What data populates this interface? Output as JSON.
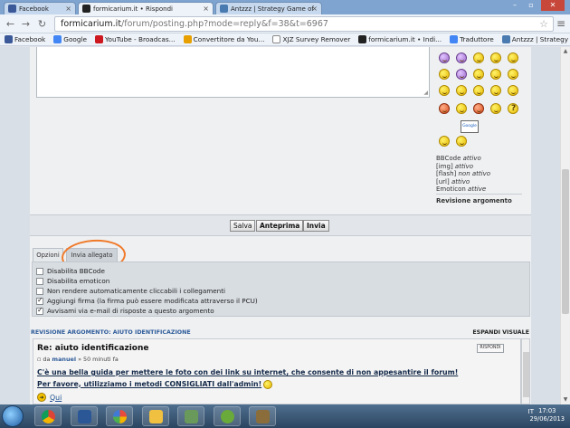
{
  "browser": {
    "tabs": [
      {
        "title": "Facebook",
        "favicon": "facebook-icon",
        "color": "#3b5998"
      },
      {
        "title": "formicarium.it • Rispondi",
        "favicon": "ant-icon",
        "color": "#222222"
      },
      {
        "title": "Antzzz | Strategy Game of",
        "favicon": "antzzz-icon",
        "color": "#4a7bb0"
      }
    ],
    "url_host": "formicarium.it",
    "url_path": "/forum/posting.php?mode=reply&f=38&t=6967",
    "bookmarks": [
      {
        "label": "Facebook",
        "icon": "facebook-icon",
        "color": "#3b5998"
      },
      {
        "label": "Google",
        "icon": "google-icon",
        "color": "#4285f4"
      },
      {
        "label": "YouTube - Broadcas...",
        "icon": "youtube-icon",
        "color": "#cc181e"
      },
      {
        "label": "Convertitore da You...",
        "icon": "converter-icon",
        "color": "#e8a000"
      },
      {
        "label": "XJZ Survey Remover",
        "icon": "page-icon",
        "color": "#ffffff"
      },
      {
        "label": "formicarium.it • Indi...",
        "icon": "ant-icon",
        "color": "#222222"
      },
      {
        "label": "Traduttore",
        "icon": "translate-icon",
        "color": "#4285f4"
      },
      {
        "label": "Antzzz | Strategy Ga...",
        "icon": "antzzz-icon",
        "color": "#4a7bb0"
      }
    ]
  },
  "sidebar": {
    "bbcode_label": "BBCode",
    "bbcode_state": "attivo",
    "img_label": "[img]",
    "img_state": "attivo",
    "flash_label": "[flash]",
    "flash_state": "non attivo",
    "url_label": "[url]",
    "url_state": "attivo",
    "emoticon_label": "Emoticon",
    "emoticon_state": "attive",
    "review_title": "Revisione argomento",
    "google_sign": "Google"
  },
  "buttons": {
    "save": "Salva",
    "preview": "Anteprima",
    "send": "Invia"
  },
  "tabs": {
    "options": "Opzioni",
    "attach": "Invia allegato"
  },
  "options": [
    {
      "label": "Disabilita BBCode",
      "checked": false
    },
    {
      "label": "Disabilita emoticon",
      "checked": false
    },
    {
      "label": "Non rendere automaticamente cliccabili i collegamenti",
      "checked": false
    },
    {
      "label": "Aggiungi firma (la firma può essere modificata attraverso il PCU)",
      "checked": true
    },
    {
      "label": "Avvisami via e-mail di risposte a questo argomento",
      "checked": true
    }
  ],
  "review": {
    "header": "REVISIONE ARGOMENTO: AIUTO IDENTIFICAZIONE",
    "expand": "ESPANDI VISUALE"
  },
  "post": {
    "title": "Re: aiuto identificazione",
    "meta_prefix": "da",
    "author": "manuel",
    "meta_time": "» 50 minuti fa",
    "quote_label": "RISPONDI",
    "line1": "C'è una bella guida per mettere le foto con dei link su internet, che consente di non appesantire il forum!",
    "line2": "Per favore, utilizziamo i metodi CONSIGLIATI dall'admin!",
    "link": "Qui"
  },
  "taskbar": {
    "lang": "IT",
    "time": "17:03",
    "date": "29/06/2013"
  }
}
